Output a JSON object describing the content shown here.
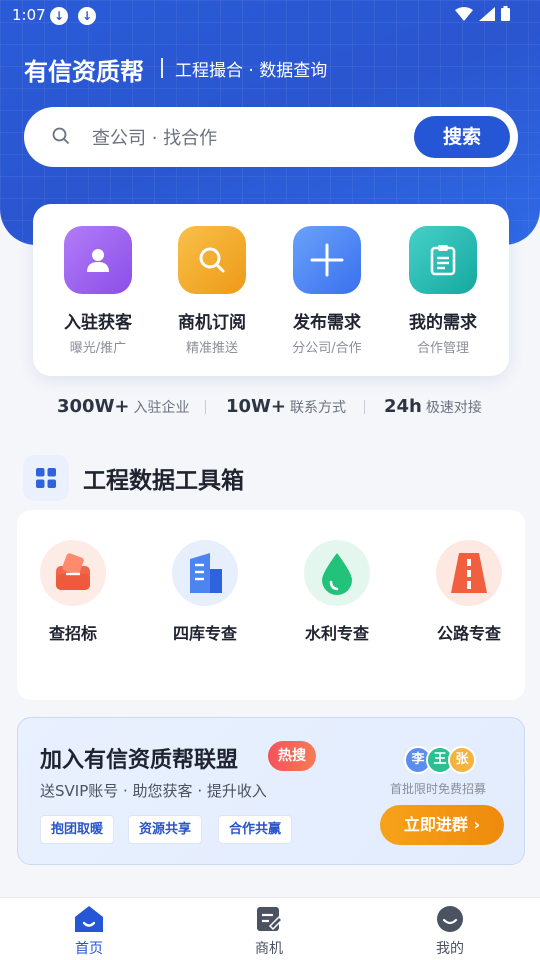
{
  "status_bar": {
    "time": "1:07"
  },
  "header": {
    "brand": "有信资质帮",
    "slogan": "工程撮合 · 数据查询"
  },
  "search": {
    "placeholder": "查公司 · 找合作",
    "button": "搜索"
  },
  "quick_actions": [
    {
      "title": "入驻获客",
      "subtitle": "曝光/推广",
      "icon": "user-icon",
      "color": "#9b5cf0"
    },
    {
      "title": "商机订阅",
      "subtitle": "精准推送",
      "icon": "search-icon",
      "color": "#f5a623"
    },
    {
      "title": "发布需求",
      "subtitle": "分公司/合作",
      "icon": "plus-icon",
      "color": "#3f7cf2"
    },
    {
      "title": "我的需求",
      "subtitle": "合作管理",
      "icon": "clipboard-icon",
      "color": "#21b8b0"
    }
  ],
  "stats": [
    {
      "value": "300W+",
      "label": "入驻企业"
    },
    {
      "value": "10W+",
      "label": "联系方式"
    },
    {
      "value": "24h",
      "label": "极速对接"
    }
  ],
  "toolbox": {
    "title": "工程数据工具箱",
    "items": [
      {
        "label": "查招标",
        "icon": "bid-box-icon"
      },
      {
        "label": "四库专查",
        "icon": "buildings-icon"
      },
      {
        "label": "水利专查",
        "icon": "water-drop-icon"
      },
      {
        "label": "公路专查",
        "icon": "road-icon"
      }
    ]
  },
  "banner": {
    "title": "加入有信资质帮联盟",
    "hot": "热搜",
    "subtitle": "送SVIP账号 · 助您获客 · 提升收入",
    "tags": [
      "抱团取暖",
      "资源共享",
      "合作共赢"
    ],
    "avatars": [
      "李",
      "王",
      "张"
    ],
    "note": "首批限时免费招募",
    "cta": "立即进群"
  },
  "tabbar": [
    {
      "label": "首页",
      "icon": "home-icon",
      "active": true
    },
    {
      "label": "商机",
      "icon": "note-edit-icon",
      "active": false
    },
    {
      "label": "我的",
      "icon": "profile-icon",
      "active": false
    }
  ],
  "colors": {
    "primary": "#2456d6",
    "accent": "#f7a21a"
  }
}
